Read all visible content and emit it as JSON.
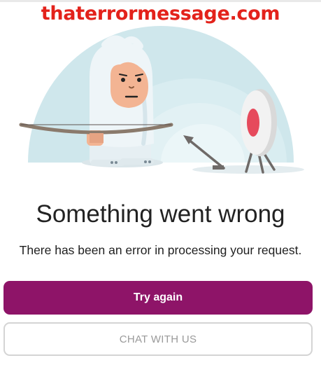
{
  "watermark": {
    "text": "thaterrormessage.com",
    "color": "#e3221b"
  },
  "illustration": {
    "description_icon": "yeti-archer-illustration",
    "colors": {
      "backdrop": "#cfe7ec",
      "yeti_fur": "#eef5f8",
      "face": "#f3b493",
      "target_ring": "#e64a5c"
    }
  },
  "error": {
    "title": "Something went wrong",
    "message": "There has been an error in processing your request."
  },
  "actions": {
    "primary_label": "Try again",
    "secondary_label": "CHAT WITH US",
    "primary_color": "#8e1468"
  }
}
